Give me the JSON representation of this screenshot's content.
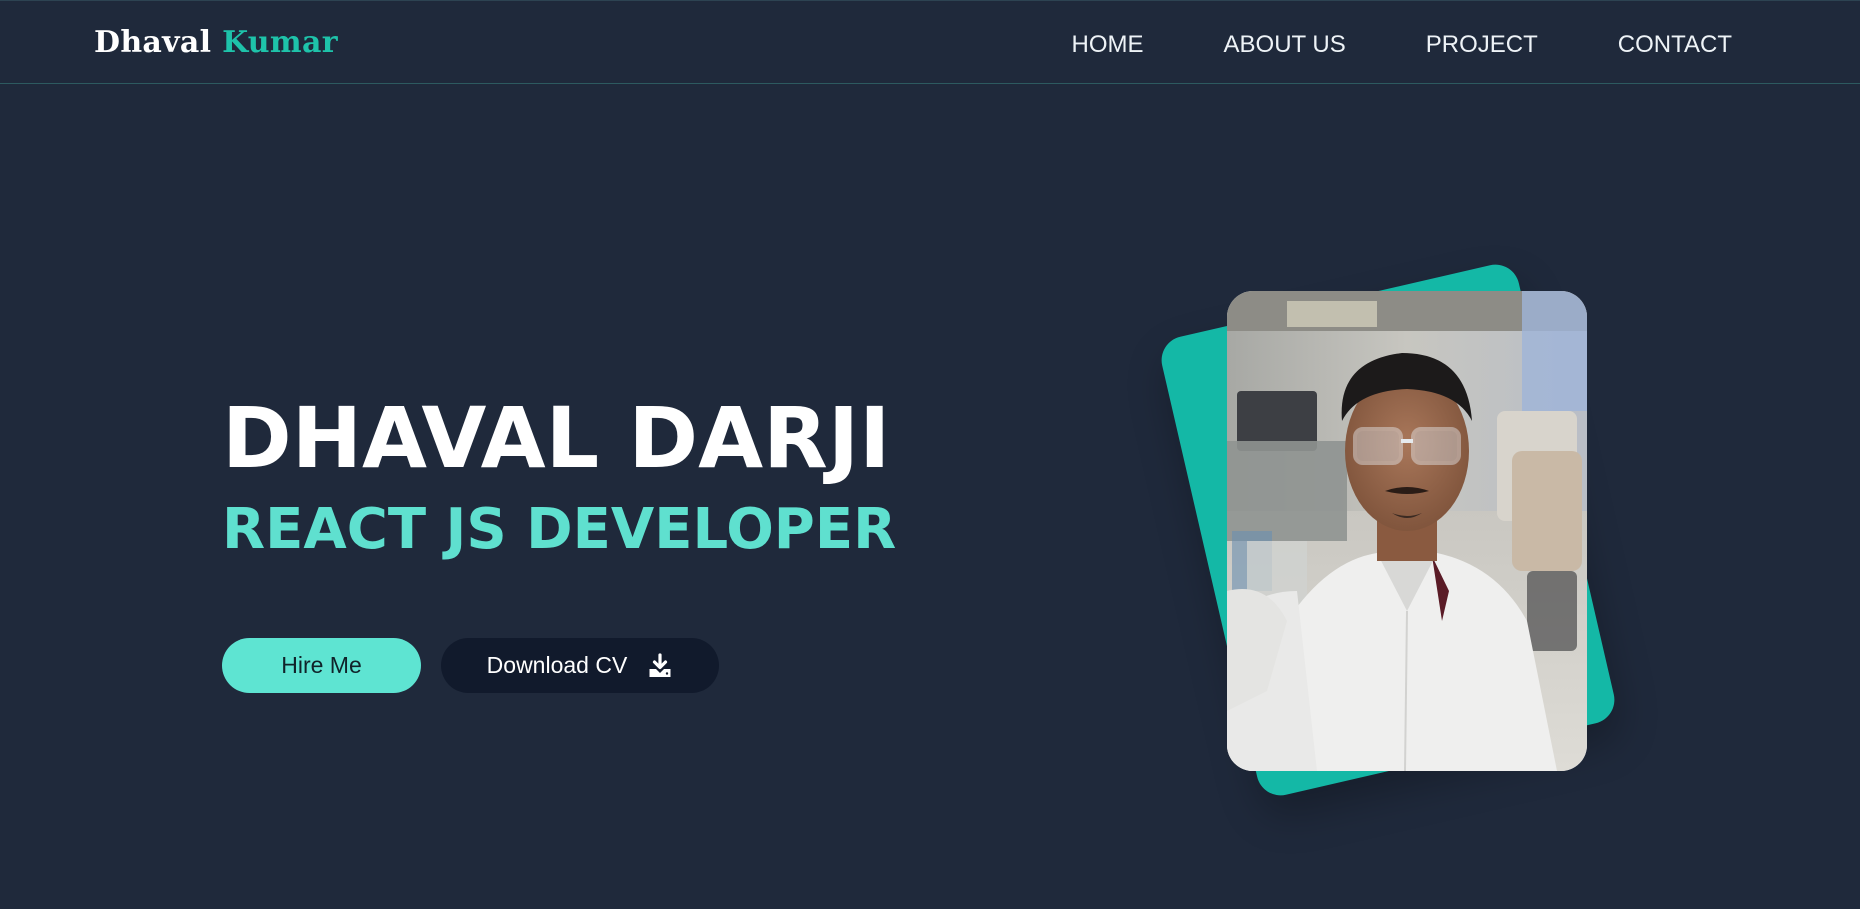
{
  "header": {
    "logo_first": "Dhaval",
    "logo_last": "Kumar",
    "nav": [
      "HOME",
      "ABOUT US",
      "PROJECT",
      "CONTACT"
    ]
  },
  "hero": {
    "name": "DHAVAL DARJI",
    "role": "REACT JS DEVELOPER",
    "hire_label": "Hire Me",
    "cv_label": "Download CV",
    "cv_icon": "download-icon"
  },
  "colors": {
    "background": "#1f293b",
    "accent": "#5fe0cf",
    "logo_accent": "#1ec3aa",
    "card": "#14b8a6",
    "dark_button": "#111a2c"
  }
}
